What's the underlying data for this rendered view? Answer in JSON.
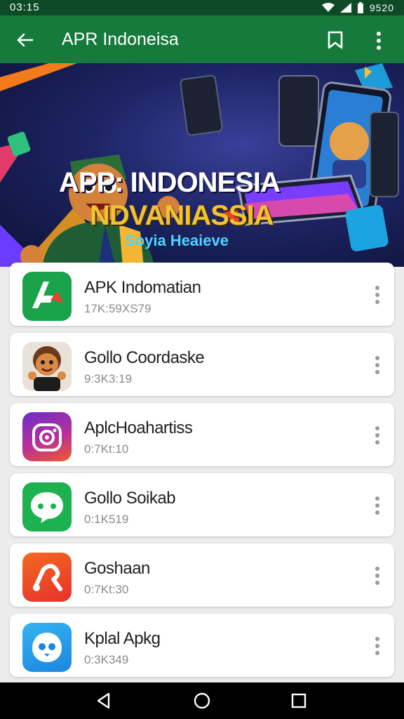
{
  "status_bar": {
    "time": "03:15",
    "clock": "9520"
  },
  "app_bar": {
    "title": "APR Indoneisa"
  },
  "banner": {
    "line1": "APP: INDONESIA",
    "line2": "NDVANIASSIA",
    "line3": "Soyia Heaieve"
  },
  "apps": [
    {
      "name": "APK Indomatian",
      "meta": "17K:59XS79",
      "icon": "apk-logo-icon",
      "color": "#1aa34a"
    },
    {
      "name": "Gollo Coordaske",
      "meta": "9:3K3:19",
      "icon": "cartoon-character-icon",
      "color": "#e9e2d8"
    },
    {
      "name": "AplcHoahartiss",
      "meta": "0:7Kt:10",
      "icon": "camera-icon",
      "color": "#8a2fc0"
    },
    {
      "name": "Gollo Soikab",
      "meta": "0:1K519",
      "icon": "chat-bubble-icon",
      "color": "#1db24f"
    },
    {
      "name": "Goshaan",
      "meta": "0:7Kt:30",
      "icon": "music-note-icon",
      "color": "#f05a1e"
    },
    {
      "name": "Kplal Apkg",
      "meta": "0:3K349",
      "icon": "bird-face-icon",
      "color": "#2196e8"
    }
  ]
}
